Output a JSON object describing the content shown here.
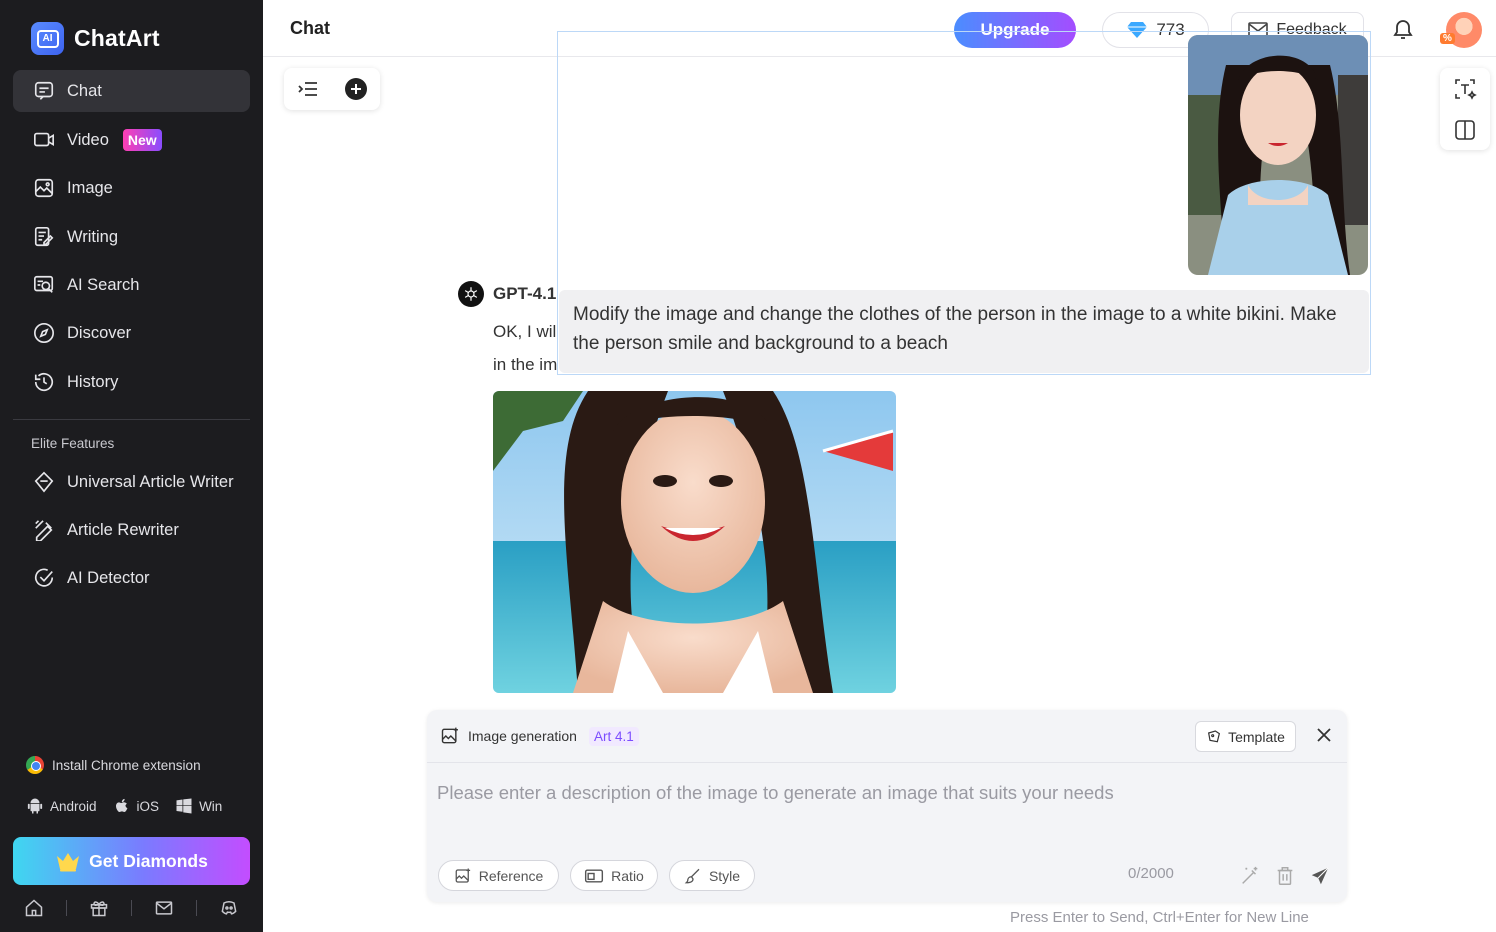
{
  "app": {
    "name": "ChatArt"
  },
  "sidebar": {
    "items": [
      {
        "label": "Chat",
        "icon": "chat-icon",
        "active": true
      },
      {
        "label": "Video",
        "icon": "video-icon",
        "badge": "New"
      },
      {
        "label": "Image",
        "icon": "image-icon"
      },
      {
        "label": "Writing",
        "icon": "writing-icon"
      },
      {
        "label": "AI Search",
        "icon": "ai-search-icon"
      },
      {
        "label": "Discover",
        "icon": "compass-icon"
      },
      {
        "label": "History",
        "icon": "history-icon"
      }
    ],
    "elite_label": "Elite Features",
    "elite_items": [
      {
        "label": "Universal Article Writer",
        "icon": "diamond-pen-icon"
      },
      {
        "label": "Article Rewriter",
        "icon": "rewriter-icon"
      },
      {
        "label": "AI Detector",
        "icon": "check-circle-icon"
      }
    ],
    "chrome_extension": "Install Chrome extension",
    "platforms": [
      "Android",
      "iOS",
      "Win"
    ],
    "get_diamonds": "Get Diamonds"
  },
  "header": {
    "title": "Chat",
    "upgrade": "Upgrade",
    "diamonds": "773",
    "feedback": "Feedback",
    "avatar_badge": "%"
  },
  "conversation": {
    "user_message": "Modify the image and change the clothes of the person in the image to a white bikini. Make the person smile and background to a beach",
    "bot_name": "GPT-4.1",
    "bot_text_line1": "OK, I wil",
    "bot_text_line2": "in the im"
  },
  "composer": {
    "mode": "Image generation",
    "model": "Art 4.1",
    "template": "Template",
    "placeholder": "Please enter a description of the image to generate an image that suits your needs",
    "reference": "Reference",
    "ratio": "Ratio",
    "style": "Style",
    "counter": "0/2000",
    "hint": "Press Enter to Send, Ctrl+Enter for New Line"
  },
  "colors": {
    "sidebar_bg": "#1c1c1f",
    "accent_purple": "#7c4dff",
    "upgrade_gradient_start": "#4b8dff",
    "upgrade_gradient_end": "#a44dff"
  }
}
